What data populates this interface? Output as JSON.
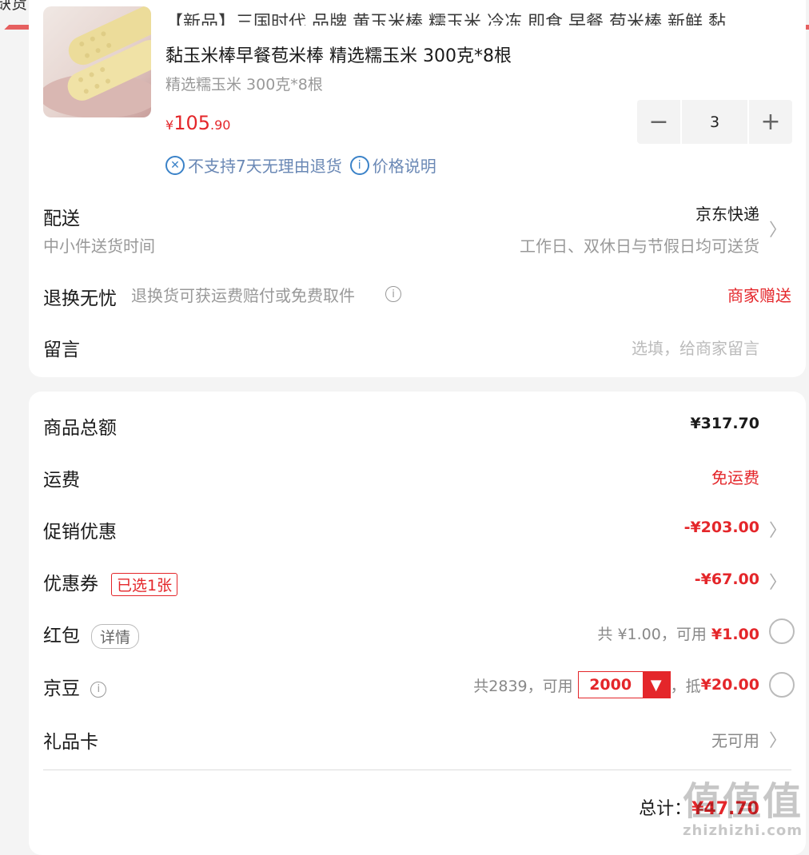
{
  "top_cut_text": "缺货",
  "product": {
    "title_line1": "【新品】三国时代 品牌 黄玉米棒 糯玉米 冷冻 即食 早餐 苞米棒 新鲜 黏",
    "title_line2": "黏玉米棒早餐苞米棒 精选糯玉米 300克*8根",
    "spec": "精选糯玉米 300克*8根",
    "price_symbol": "¥",
    "price_int": "105",
    "price_dec": ".90",
    "quantity": "3",
    "no_return": "不支持7天无理由退货",
    "price_note": "价格说明"
  },
  "delivery": {
    "label": "配送",
    "sub": "中小件送货时间",
    "method": "京东快递",
    "time": "工作日、双休日与节假日均可送货"
  },
  "return_worry": {
    "label": "退换无忧",
    "sub": "退换货可获运费赔付或免费取件",
    "value": "商家赠送"
  },
  "message": {
    "label": "留言",
    "placeholder": "选填，给商家留言"
  },
  "summary": {
    "goods_total_label": "商品总额",
    "goods_total": "¥317.70",
    "shipping_label": "运费",
    "shipping_value": "免运费",
    "promo_label": "促销优惠",
    "promo_value": "-¥203.00",
    "coupon_label": "优惠券",
    "coupon_badge": "已选1张",
    "coupon_value": "-¥67.00",
    "redpacket_label": "红包",
    "redpacket_detail": "详情",
    "redpacket_prefix": "共 ¥1.00，可用 ",
    "redpacket_value": "¥1.00",
    "jingdou_label": "京豆",
    "jingdou_prefix": "共2839，可用",
    "jingdou_select": "2000",
    "jingdou_offset_prefix": "，抵",
    "jingdou_offset": "¥20.00",
    "giftcard_label": "礼品卡",
    "giftcard_value": "无可用",
    "total_label": "总计：",
    "total_value": "¥47.70"
  },
  "watermark": {
    "line1": "值值值",
    "line2": "zhizhizhi.com"
  },
  "colors": {
    "accent_red": "#e4262a",
    "link_blue": "#3a82c8"
  },
  "icons": {
    "minus": "minus-icon",
    "plus": "plus-icon",
    "chevron": "chevron-right-icon",
    "info": "info-icon",
    "no_return": "no-return-icon",
    "dropdown": "chevron-down-icon"
  }
}
